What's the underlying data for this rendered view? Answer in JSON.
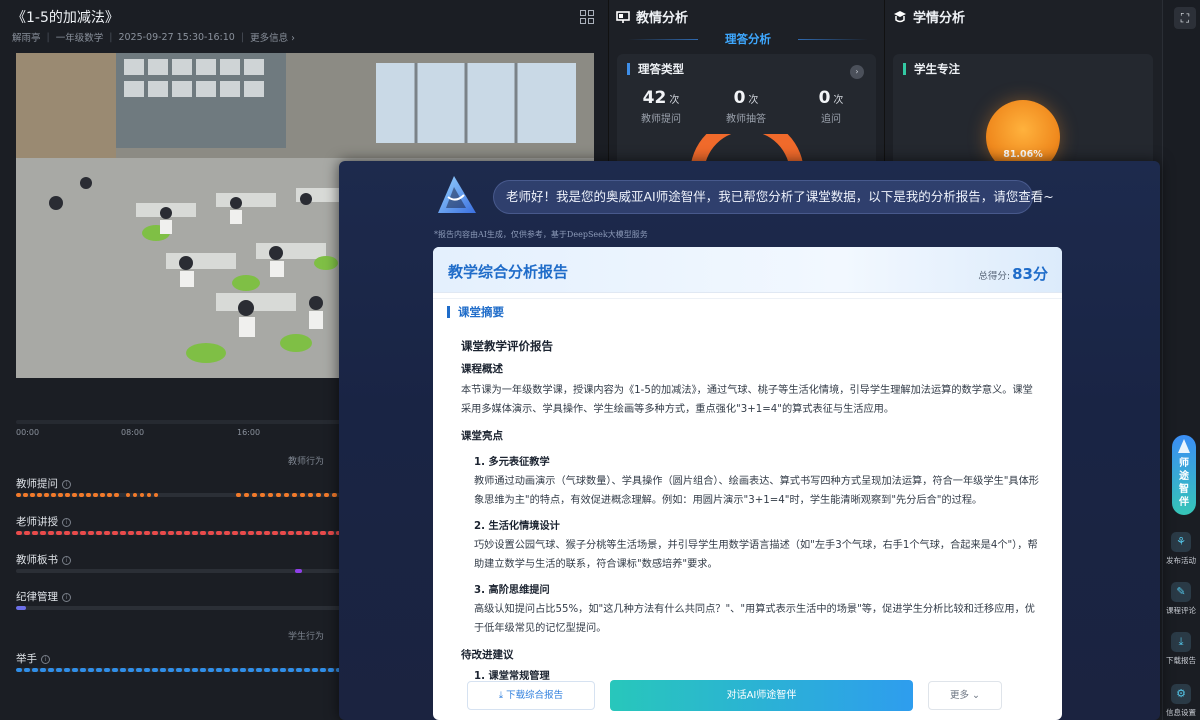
{
  "left": {
    "title": "《1-5的加减法》",
    "meta": [
      "解雨亭",
      "一年级数学",
      "2025-09-27 15:30-16:10",
      "更多信息 ›"
    ],
    "ticks": [
      "00:00",
      "08:00",
      "16:00"
    ],
    "section_teacher": "教师行为",
    "section_student": "学生行为",
    "rows": [
      {
        "label": "教师提问",
        "info": "i"
      },
      {
        "label": "老师讲授",
        "info": "i"
      },
      {
        "label": "教师板书",
        "info": "i"
      },
      {
        "label": "纪律管理",
        "info": "i"
      },
      {
        "label": "举手",
        "info": "i"
      }
    ],
    "colors": {
      "question": "#f27a2a",
      "lecture": "#e94b4b",
      "board": "#8f3fe8",
      "discipline": "#6c6fe8",
      "handsup": "#2f8ee8"
    }
  },
  "mid": {
    "head": "教情分析",
    "subtab": "理答分析",
    "card_title": "理答类型",
    "stats": [
      {
        "num": "42",
        "unit": "次",
        "label": "教师提问"
      },
      {
        "num": "0",
        "unit": "次",
        "label": "教师抽答"
      },
      {
        "num": "0",
        "unit": "次",
        "label": "追问"
      }
    ],
    "more": "›"
  },
  "right": {
    "head": "学情分析",
    "card_title": "学生专注",
    "focus_percent": "81.06%"
  },
  "sidebar": {
    "fullscreen": "⛶",
    "ai_label": "师途智伴",
    "items": [
      {
        "label": "发布活动",
        "icon": "⚘"
      },
      {
        "label": "课程评论",
        "icon": "✎"
      },
      {
        "label": "下载报告",
        "icon": "⤓"
      },
      {
        "label": "信息设置",
        "icon": "⚙"
      }
    ]
  },
  "modal": {
    "greeting": "老师好！我是您的奥威亚AI师途智伴，我已帮您分析了课堂数据，以下是我的分析报告，请您查看~",
    "disclaimer": "*报告内容由AI生成，仅供参考，基于DeepSeek大模型服务",
    "report": {
      "title": "教学综合分析报告",
      "score_label": "总得分:",
      "score": "83分",
      "section": "课堂摘要",
      "heading": "课堂教学评价报告",
      "overview_h": "课程概述",
      "overview": "本节课为一年级数学课，授课内容为《1-5的加减法》，通过气球、桃子等生活化情境，引导学生理解加法运算的数学意义。课堂采用多媒体演示、学具操作、学生绘画等多种方式，重点强化\"3+1=4\"的算式表征与生活应用。",
      "highlights_h": "课堂亮点",
      "highlights": [
        {
          "title": "1. 多元表征教学",
          "text": "教师通过动画演示（气球数量）、学具操作（圆片组合）、绘画表达、算式书写四种方式呈现加法运算，符合一年级学生\"具体形象思维为主\"的特点，有效促进概念理解。例如：用圆片演示\"3+1=4\"时，学生能清晰观察到\"先分后合\"的过程。"
        },
        {
          "title": "2. 生活化情境设计",
          "text": "巧妙设置公园气球、猴子分桃等生活场景，并引导学生用数学语言描述（如\"左手3个气球，右手1个气球，合起来是4个\"），帮助建立数学与生活的联系，符合课标\"数感培养\"要求。"
        },
        {
          "title": "3. 高阶思维提问",
          "text": "高级认知提问占比55%，如\"这几种方法有什么共同点？\"、\"用算式表示生活中的场景\"等，促进学生分析比较和迁移应用，优于低年级常见的记忆型提问。"
        }
      ],
      "improve_h": "待改进建议",
      "improve_1": "1. 课堂常规管理"
    },
    "buttons": {
      "download": "下载综合报告",
      "chat": "对话AI师途智伴",
      "more": "更多 ⌄"
    }
  }
}
